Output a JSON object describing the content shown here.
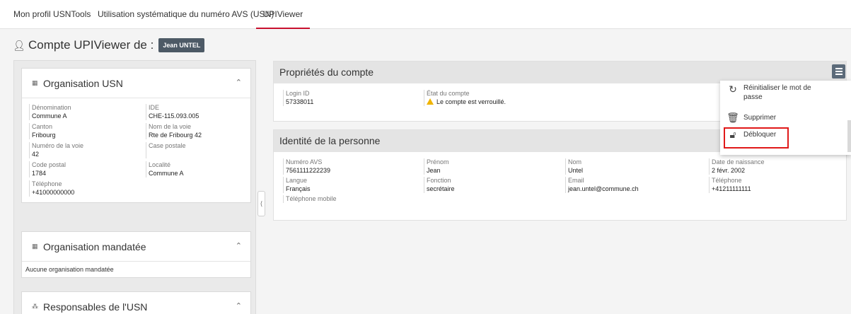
{
  "tabs": [
    {
      "label": "Mon profil USNTools"
    },
    {
      "label": "Utilisation systématique du numéro AVS (USN)"
    },
    {
      "label": "UPIViewer"
    }
  ],
  "header": {
    "title": "Compte UPIViewer de :",
    "user": "Jean UNTEL",
    "icon": "user-edit-icon"
  },
  "left": {
    "org_usn": {
      "title": "Organisation USN",
      "fields": [
        {
          "label": "Dénomination",
          "value": "Commune A"
        },
        {
          "label": "IDE",
          "value": "CHE-115.093.005"
        },
        {
          "label": "Canton",
          "value": "Fribourg"
        },
        {
          "label": "Nom de la voie",
          "value": "Rte de Fribourg 42"
        },
        {
          "label": "Numéro de la voie",
          "value": "42"
        },
        {
          "label": "Case postale",
          "value": ""
        },
        {
          "label": "Code postal",
          "value": "1784"
        },
        {
          "label": "Localité",
          "value": "Commune A"
        },
        {
          "label": "Téléphone",
          "value": "+41000000000"
        }
      ]
    },
    "org_mandatee": {
      "title": "Organisation mandatée",
      "empty": "Aucune organisation mandatée"
    },
    "responsables": {
      "title": "Responsables de l'USN"
    }
  },
  "account": {
    "title": "Propriétés du compte",
    "login_label": "Login ID",
    "login_value": "57338011",
    "state_label": "État du compte",
    "state_value": "Le compte est verrouillé."
  },
  "person": {
    "title": "Identité de la personne",
    "fields": [
      {
        "label": "Numéro AVS",
        "value": "7561111222239"
      },
      {
        "label": "Prénom",
        "value": "Jean"
      },
      {
        "label": "Nom",
        "value": "Untel"
      },
      {
        "label": "Date de naissance",
        "value": "2 févr. 2002"
      },
      {
        "label": "Langue",
        "value": "Français"
      },
      {
        "label": "Fonction",
        "value": "secrétaire"
      },
      {
        "label": "Email",
        "value": "jean.untel@commune.ch"
      },
      {
        "label": "Téléphone",
        "value": "+41211111111"
      },
      {
        "label": "Téléphone mobile",
        "value": ""
      }
    ]
  },
  "menu": {
    "items": [
      {
        "label": "Réinitialiser le mot de passe",
        "icon": "refresh-icon"
      },
      {
        "label": "Supprimer",
        "icon": "trash-icon"
      },
      {
        "label": "Débloquer",
        "icon": "unlock-icon"
      }
    ]
  },
  "colors": {
    "accent": "#c8102e",
    "badge": "#4d5a66",
    "highlight": "#e01919",
    "warning": "#f0b400"
  }
}
